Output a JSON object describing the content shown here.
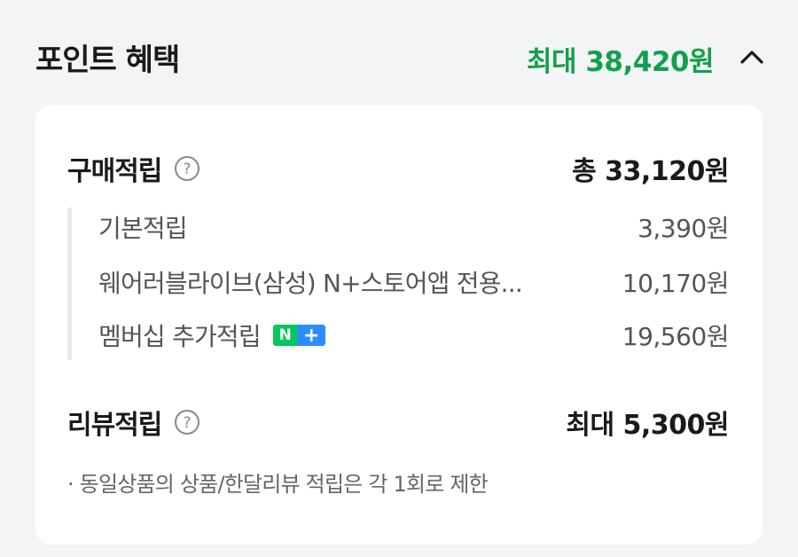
{
  "header": {
    "title": "포인트 혜택",
    "max_points": "최대 38,420원"
  },
  "purchase": {
    "label": "구매적립",
    "total": "총 33,120원",
    "items": [
      {
        "label": "기본적립",
        "value": "3,390원"
      },
      {
        "label": "웨어러블라이브(삼성) N+스토어앱 전용...",
        "value": "10,170원"
      },
      {
        "label": "멤버십 추가적립",
        "value": "19,560원",
        "badge": {
          "n": "N",
          "plus": "+"
        }
      }
    ]
  },
  "review": {
    "label": "리뷰적립",
    "total": "최대 5,300원",
    "note": "· 동일상품의 상품/한달리뷰 적립은 각 1회로 제한"
  },
  "colors": {
    "accent_green": "#12a14b",
    "badge_green": "#03c75a",
    "badge_blue": "#2d8cff"
  },
  "icons": {
    "collapse": "chevron-up-icon",
    "help": "question-circle-icon"
  }
}
